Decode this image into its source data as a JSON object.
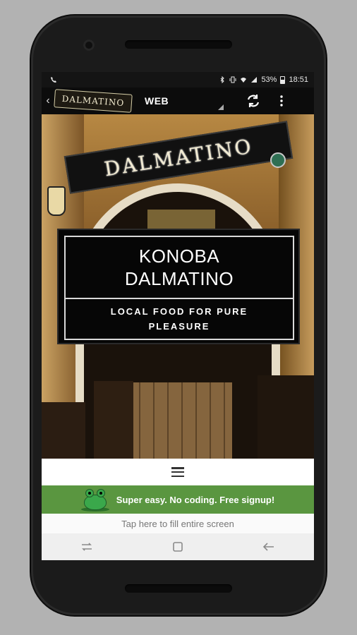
{
  "status_bar": {
    "battery": "53%",
    "time": "18:51"
  },
  "toolbar": {
    "logo_text": "DALMATINO",
    "selected_tab": "WEB"
  },
  "hero": {
    "sign_text": "DALMATINO",
    "title_line1": "KONOBA",
    "title_line2": "DALMATINO",
    "subtitle_line1": "LOCAL FOOD FOR PURE",
    "subtitle_line2": "PLEASURE"
  },
  "promo": {
    "text": "Super easy. No coding. Free signup!"
  },
  "tap_hint": "Tap here to fill entire screen",
  "colors": {
    "promo_green": "#5a9640",
    "toolbar_bg": "#0c0c0c",
    "phone_body": "#1b1b1b",
    "page_bg": "#b2b2b2"
  },
  "icons": [
    "phone-call-icon",
    "bluetooth-icon",
    "vibrate-icon",
    "wifi-icon",
    "signal-icon",
    "battery-icon",
    "alarm-icon",
    "back-icon",
    "refresh-icon",
    "more-vert-icon",
    "hamburger-icon",
    "frog-icon",
    "recent-apps-icon",
    "home-icon",
    "nav-back-icon"
  ]
}
